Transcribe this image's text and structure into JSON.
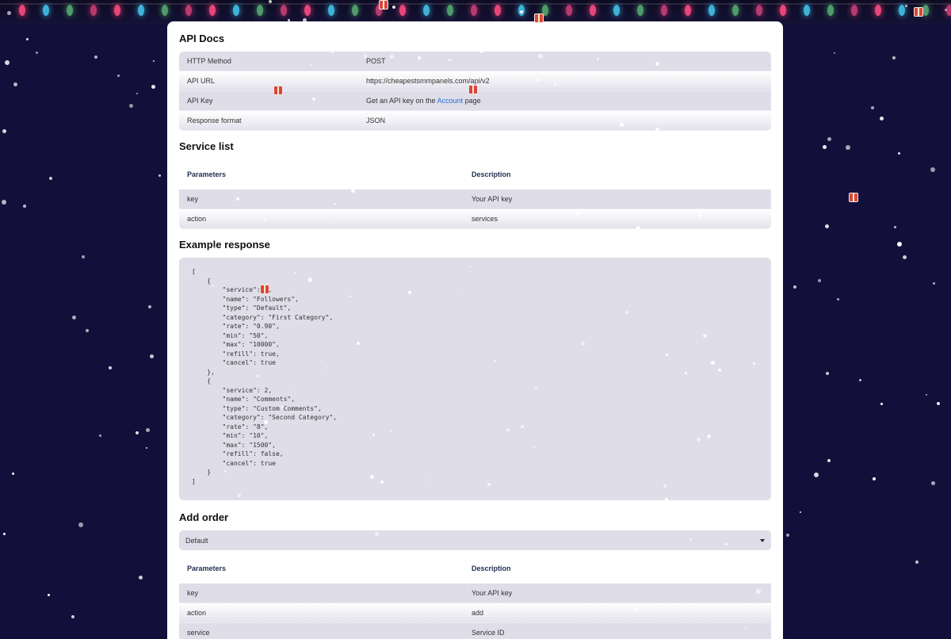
{
  "api_docs": {
    "title": "API Docs",
    "rows": [
      {
        "label": "HTTP Method",
        "value": "POST"
      },
      {
        "label": "API URL",
        "value": "https://cheapestsmmpanels.com/api/v2"
      },
      {
        "label": "API Key",
        "value_prefix": "Get an API key on the",
        "link": "Account",
        "value_suffix": "page"
      },
      {
        "label": "Response format",
        "value": "JSON"
      }
    ]
  },
  "service_list": {
    "title": "Service list",
    "headers": [
      "Parameters",
      "Description"
    ],
    "rows": [
      {
        "param": "key",
        "desc": "Your API key"
      },
      {
        "param": "action",
        "desc": "services"
      }
    ]
  },
  "example_response": {
    "title": "Example response",
    "code": "[\n    {\n        \"service\": 1,\n        \"name\": \"Followers\",\n        \"type\": \"Default\",\n        \"category\": \"First Category\",\n        \"rate\": \"0.90\",\n        \"min\": \"50\",\n        \"max\": \"10000\",\n        \"refill\": true,\n        \"cancel\": true\n    },\n    {\n        \"service\": 2,\n        \"name\": \"Comments\",\n        \"type\": \"Custom Comments\",\n        \"category\": \"Second Category\",\n        \"rate\": \"8\",\n        \"min\": \"10\",\n        \"max\": \"1500\",\n        \"refill\": false,\n        \"cancel\": true\n    }\n]"
  },
  "add_order": {
    "title": "Add order",
    "select_value": "Default",
    "headers": [
      "Parameters",
      "Description"
    ],
    "rows": [
      {
        "param": "key",
        "desc": "Your API key"
      },
      {
        "param": "action",
        "desc": "add"
      },
      {
        "param": "service",
        "desc": "Service ID"
      }
    ]
  },
  "colors": {
    "background": "#12103a",
    "card": "#ffffff",
    "row": "#dedde8",
    "link": "#2a6fd6"
  },
  "icons": [
    "chevron-down-icon",
    "gift-icon",
    "snowflake-icon",
    "light-bulb-icon"
  ]
}
